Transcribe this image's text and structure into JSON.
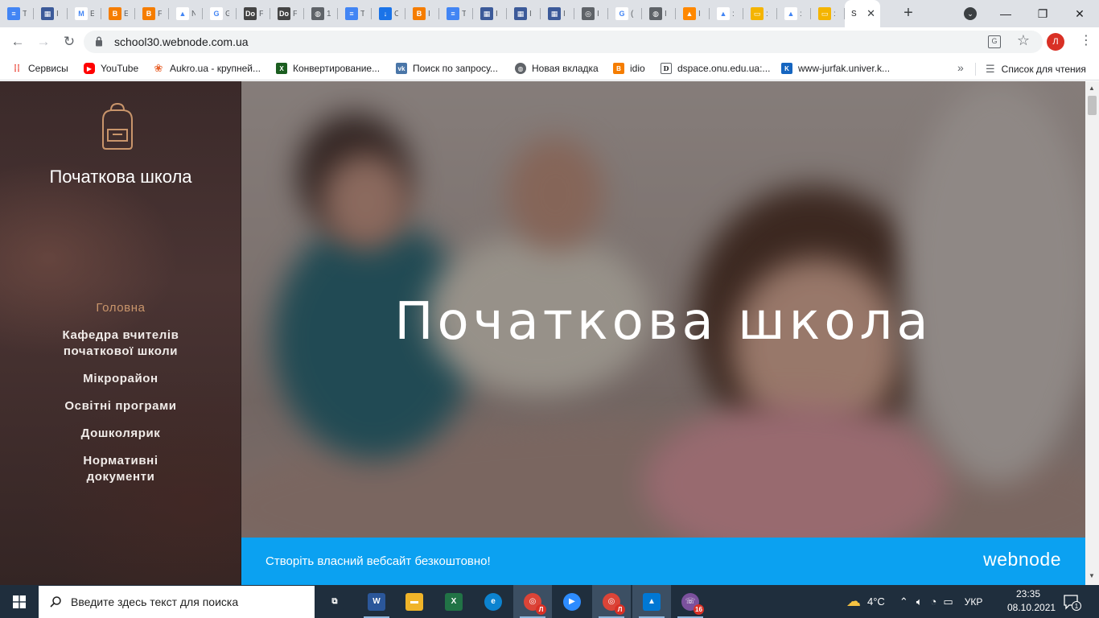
{
  "browser": {
    "tabs": [
      {
        "label": "T",
        "favicon": "docs-icon",
        "color": "#4285f4",
        "glyph": "≡"
      },
      {
        "label": "I",
        "favicon": "webnode-icon",
        "color": "#3c5a99",
        "glyph": "▦"
      },
      {
        "label": "E",
        "favicon": "gmail-icon",
        "color": "#ffffff",
        "glyph": "M"
      },
      {
        "label": "E",
        "favicon": "blogger-icon",
        "color": "#f57d00",
        "glyph": "B"
      },
      {
        "label": "F",
        "favicon": "blogger-icon",
        "color": "#f57d00",
        "glyph": "B"
      },
      {
        "label": "N",
        "favicon": "drive-icon",
        "color": "#ffffff",
        "glyph": "▲"
      },
      {
        "label": "G",
        "favicon": "google-icon",
        "color": "#ffffff",
        "glyph": "G"
      },
      {
        "label": "F",
        "favicon": "docme-icon",
        "color": "#444444",
        "glyph": "Do"
      },
      {
        "label": "F",
        "favicon": "docme-icon",
        "color": "#444444",
        "glyph": "Do"
      },
      {
        "label": "1",
        "favicon": "globe-icon",
        "color": "#5f6368",
        "glyph": "◍"
      },
      {
        "label": "T",
        "favicon": "docs-icon",
        "color": "#4285f4",
        "glyph": "≡"
      },
      {
        "label": "C",
        "favicon": "download-icon",
        "color": "#1a73e8",
        "glyph": "↓"
      },
      {
        "label": "I",
        "favicon": "blogger-icon",
        "color": "#f57d00",
        "glyph": "B"
      },
      {
        "label": "T",
        "favicon": "docs-icon",
        "color": "#4285f4",
        "glyph": "≡"
      },
      {
        "label": "I",
        "favicon": "webnode-icon",
        "color": "#3c5a99",
        "glyph": "▦"
      },
      {
        "label": "I",
        "favicon": "webnode-icon",
        "color": "#3c5a99",
        "glyph": "▦"
      },
      {
        "label": "I",
        "favicon": "webnode-icon",
        "color": "#3c5a99",
        "glyph": "▦"
      },
      {
        "label": "I",
        "favicon": "chrome-icon",
        "color": "#5f6368",
        "glyph": "◎"
      },
      {
        "label": "(",
        "favicon": "google-icon",
        "color": "#ffffff",
        "glyph": "G"
      },
      {
        "label": "I",
        "favicon": "globe-icon",
        "color": "#5f6368",
        "glyph": "◍"
      },
      {
        "label": "I",
        "favicon": "vlc-icon",
        "color": "#ff8800",
        "glyph": "▲"
      },
      {
        "label": ":",
        "favicon": "drive-icon",
        "color": "#ffffff",
        "glyph": "▲"
      },
      {
        "label": ":",
        "favicon": "slides-icon",
        "color": "#f4b400",
        "glyph": "▭"
      },
      {
        "label": ":",
        "favicon": "drive-icon",
        "color": "#ffffff",
        "glyph": "▲"
      },
      {
        "label": ":",
        "favicon": "slides-icon",
        "color": "#f4b400",
        "glyph": "▭"
      }
    ],
    "active_tab": {
      "label": "S"
    },
    "url": "school30.webnode.com.ua",
    "profile_initial": "Л",
    "bookmarks": [
      {
        "label": "Сервисы",
        "icon": "apps-grid-icon",
        "color": "#ea4335",
        "glyph": "⁞⁞"
      },
      {
        "label": "YouTube",
        "icon": "youtube-icon",
        "color": "#ff0000",
        "glyph": "▶"
      },
      {
        "label": "Aukro.ua - крупней...",
        "icon": "aukro-paw-icon",
        "color": "#e8622c",
        "glyph": "❀"
      },
      {
        "label": "Конвертирование...",
        "icon": "converter-icon",
        "color": "#1b5e20",
        "glyph": "X"
      },
      {
        "label": "Поиск по запросу...",
        "icon": "vk-icon",
        "color": "#4a76a8",
        "glyph": "vk"
      },
      {
        "label": "Новая вкладка",
        "icon": "globe-icon",
        "color": "#5f6368",
        "glyph": "◍"
      },
      {
        "label": "idio",
        "icon": "blogger-icon",
        "color": "#f57d00",
        "glyph": "B"
      },
      {
        "label": "dspace.onu.edu.ua:...",
        "icon": "dspace-icon",
        "color": "#ffffff",
        "glyph": "D"
      },
      {
        "label": "www-jurfak.univer.k...",
        "icon": "jurfak-icon",
        "color": "#1565c0",
        "glyph": "K"
      }
    ],
    "reading_list": "Список для чтения"
  },
  "page": {
    "site_title": "Початкова школа",
    "nav": [
      {
        "label": "Головна",
        "active": true
      },
      {
        "label": "Кафедра вчителів початкової школи",
        "active": false
      },
      {
        "label": "Мікрорайон",
        "active": false
      },
      {
        "label": "Освітні програми",
        "active": false
      },
      {
        "label": "Дошколярик",
        "active": false
      },
      {
        "label": "Нормативні документи",
        "active": false
      }
    ],
    "hero_title": "Початкова школа",
    "banner_text": "Створіть власний вебсайт безкоштовно!",
    "banner_logo": "webnode",
    "accent_color": "#c9956b",
    "banner_color": "#0ba1f1"
  },
  "taskbar": {
    "search_placeholder": "Введите здесь текст для поиска",
    "apps": [
      {
        "name": "task-view",
        "color": "#1f2e3d",
        "glyph": "⧉",
        "running": false,
        "highlight": false
      },
      {
        "name": "word",
        "color": "#2b579a",
        "glyph": "W",
        "running": true,
        "highlight": false
      },
      {
        "name": "file-explorer",
        "color": "#f0b429",
        "glyph": "▬",
        "running": false,
        "highlight": false
      },
      {
        "name": "excel",
        "color": "#217346",
        "glyph": "X",
        "running": false,
        "highlight": false
      },
      {
        "name": "edge",
        "color": "#0c83d0",
        "glyph": "e",
        "running": false,
        "highlight": false
      },
      {
        "name": "chrome-profile",
        "color": "#db4437",
        "glyph": "◎",
        "running": true,
        "highlight": true,
        "badge": "Л"
      },
      {
        "name": "zoom",
        "color": "#2d8cff",
        "glyph": "▶",
        "running": false,
        "highlight": false
      },
      {
        "name": "chrome",
        "color": "#db4437",
        "glyph": "◎",
        "running": true,
        "highlight": true,
        "badge": "Л"
      },
      {
        "name": "photos",
        "color": "#0078d4",
        "glyph": "▲",
        "running": true,
        "highlight": true
      },
      {
        "name": "viber",
        "color": "#7b519d",
        "glyph": "☏",
        "running": true,
        "highlight": false,
        "badge": "16"
      }
    ],
    "weather": "4°C",
    "language": "УКР",
    "time": "23:35",
    "date": "08.10.2021",
    "notifications": "1"
  }
}
